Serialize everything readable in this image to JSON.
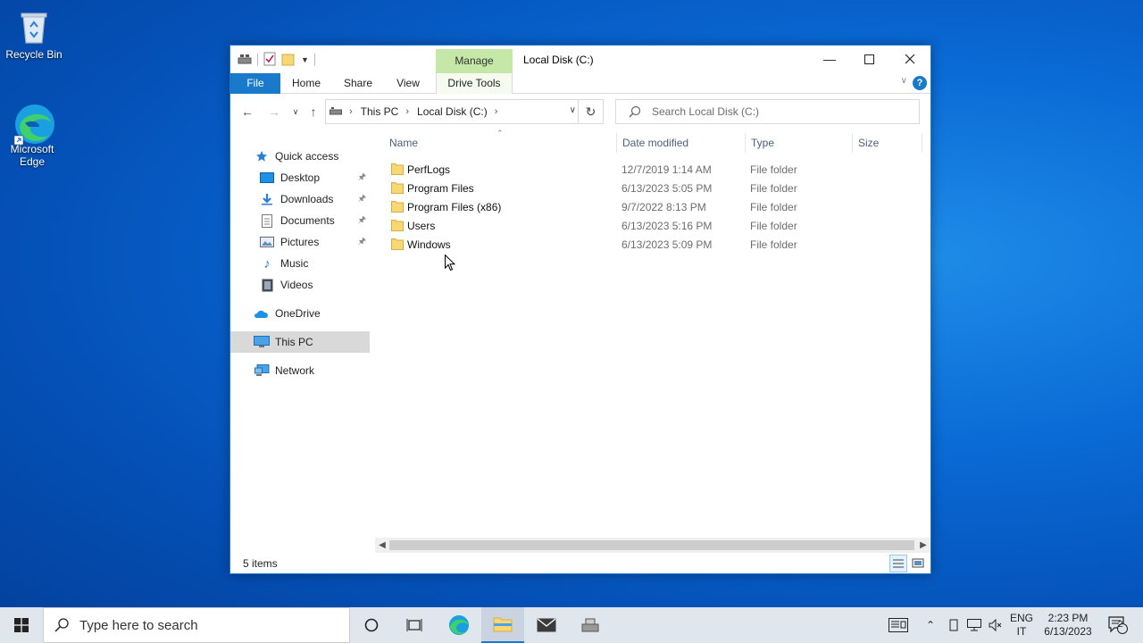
{
  "desktop": {
    "icons": [
      {
        "label": "Recycle Bin"
      },
      {
        "label": "Microsoft Edge"
      }
    ]
  },
  "window": {
    "title": "Local Disk (C:)",
    "manage_tab": "Manage",
    "ribbon_tabs": [
      {
        "label": "File"
      },
      {
        "label": "Home"
      },
      {
        "label": "Share"
      },
      {
        "label": "View"
      },
      {
        "label": "Drive Tools"
      }
    ],
    "help_label": "?",
    "address": {
      "crumbs": [
        "This PC",
        "Local Disk (C:)"
      ]
    },
    "search": {
      "placeholder": "Search Local Disk (C:)"
    },
    "nav": {
      "quick_access": "Quick access",
      "items": [
        {
          "label": "Desktop"
        },
        {
          "label": "Downloads"
        },
        {
          "label": "Documents"
        },
        {
          "label": "Pictures"
        },
        {
          "label": "Music"
        },
        {
          "label": "Videos"
        }
      ],
      "onedrive": "OneDrive",
      "this_pc": "This PC",
      "network": "Network"
    },
    "columns": {
      "name": "Name",
      "date": "Date modified",
      "type": "Type",
      "size": "Size"
    },
    "files": [
      {
        "name": "PerfLogs",
        "date": "12/7/2019 1:14 AM",
        "type": "File folder"
      },
      {
        "name": "Program Files",
        "date": "6/13/2023 5:05 PM",
        "type": "File folder"
      },
      {
        "name": "Program Files (x86)",
        "date": "9/7/2022 8:13 PM",
        "type": "File folder"
      },
      {
        "name": "Users",
        "date": "6/13/2023 5:16 PM",
        "type": "File folder"
      },
      {
        "name": "Windows",
        "date": "6/13/2023 5:09 PM",
        "type": "File folder"
      }
    ],
    "status": "5 items"
  },
  "taskbar": {
    "search_placeholder": "Type here to search",
    "language": "ENG",
    "keyboard": "IT",
    "time": "2:23 PM",
    "date": "6/13/2023",
    "notifications": "2"
  },
  "colors": {
    "accent": "#1979ca",
    "manage_tab": "#c5e8a8",
    "folder": "#f8d775"
  }
}
